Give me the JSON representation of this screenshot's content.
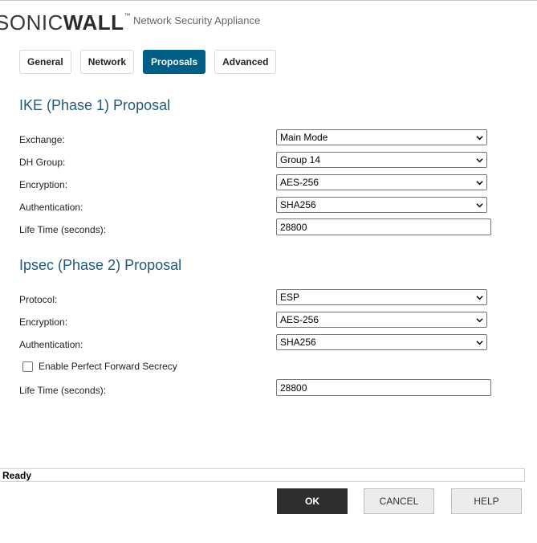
{
  "header": {
    "logo_prefix": "SONIC",
    "logo_suffix": "WALL",
    "logo_tm": "™",
    "subtitle": "Network Security Appliance"
  },
  "tabs": [
    {
      "label": "General",
      "active": false
    },
    {
      "label": "Network",
      "active": false
    },
    {
      "label": "Proposals",
      "active": true
    },
    {
      "label": "Advanced",
      "active": false
    }
  ],
  "ike": {
    "title": "IKE (Phase 1) Proposal",
    "exchange": {
      "label": "Exchange:",
      "value": "Main Mode"
    },
    "dh_group": {
      "label": "DH Group:",
      "value": "Group 14"
    },
    "encryption": {
      "label": "Encryption:",
      "value": "AES-256"
    },
    "authentication": {
      "label": "Authentication:",
      "value": "SHA256"
    },
    "lifetime": {
      "label": "Life Time (seconds):",
      "value": "28800"
    }
  },
  "ipsec": {
    "title": "Ipsec (Phase 2) Proposal",
    "protocol": {
      "label": "Protocol:",
      "value": "ESP"
    },
    "encryption": {
      "label": "Encryption:",
      "value": "AES-256"
    },
    "authentication": {
      "label": "Authentication:",
      "value": "SHA256"
    },
    "pfs": {
      "label": "Enable Perfect Forward Secrecy",
      "checked": false
    },
    "lifetime": {
      "label": "Life Time (seconds):",
      "value": "28800"
    }
  },
  "status": {
    "text": "Ready"
  },
  "buttons": {
    "ok": "OK",
    "cancel": "CANCEL",
    "help": "HELP"
  },
  "colors": {
    "accent": "#005f86",
    "heading": "#1f5a7a",
    "ok_button": "#2e2e2e"
  },
  "icons": {
    "dropdown": "chevron-down-icon"
  }
}
